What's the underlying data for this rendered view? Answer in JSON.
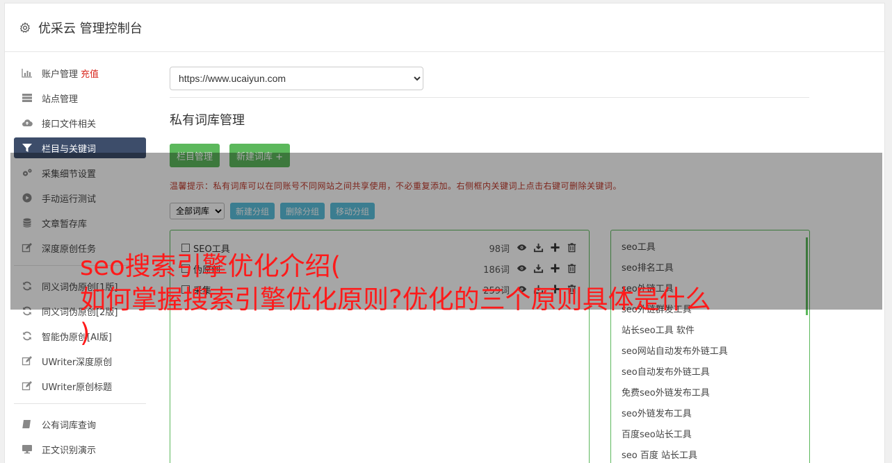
{
  "app": {
    "title": "优采云 管理控制台"
  },
  "sidebar": {
    "group1": [
      {
        "icon": "bar-chart-icon",
        "label": "账户管理",
        "extra": "充值"
      },
      {
        "icon": "server-icon",
        "label": "站点管理"
      },
      {
        "icon": "cloud-upload-icon",
        "label": "接口文件相关"
      },
      {
        "icon": "filter-icon",
        "label": "栏目与关键词",
        "active": true
      },
      {
        "icon": "cogs-icon",
        "label": "采集细节设置"
      },
      {
        "icon": "play-icon",
        "label": "手动运行测试"
      },
      {
        "icon": "database-icon",
        "label": "文章暂存库"
      },
      {
        "icon": "edit-icon",
        "label": "深度原创任务"
      }
    ],
    "group2": [
      {
        "icon": "refresh-icon",
        "label": "同义词伪原创[1版]"
      },
      {
        "icon": "refresh-icon",
        "label": "同义词伪原创[2版]"
      },
      {
        "icon": "refresh-icon",
        "label": "智能伪原创[AI版]"
      },
      {
        "icon": "edit-icon",
        "label": "UWriter深度原创"
      },
      {
        "icon": "edit-icon",
        "label": "UWriter原创标题"
      }
    ],
    "group3": [
      {
        "icon": "book-icon",
        "label": "公有词库查询"
      },
      {
        "icon": "monitor-icon",
        "label": "正文识别演示"
      }
    ]
  },
  "main": {
    "site_select": "https://www.ucaiyun.com",
    "section_title": "私有词库管理",
    "btn_column": "栏目管理",
    "btn_new_lib": "新建词库 +",
    "tip": "温馨提示：私有词库可以在同账号不同网站之间共享使用，不必重复添加。右侧框内关键词上点击右键可删除关键词。",
    "filter_select": "全部词库",
    "btn_new_group": "新建分组",
    "btn_del_group": "删除分组",
    "btn_move_group": "移动分组",
    "libraries": [
      {
        "name": "SEO工具",
        "count": "98词"
      },
      {
        "name": "伪原创",
        "count": "186词"
      },
      {
        "name": "采集",
        "count": "259词"
      }
    ],
    "keywords": [
      "seo工具",
      "seo排名工具",
      "seo外链工具",
      "seo外链群发工具",
      "站长seo工具 软件",
      "seo网站自动发布外链工具",
      "seo自动发布外链工具",
      "免费seo外链发布工具",
      "seo外链发布工具",
      "百度seo站长工具",
      "seo 百度 站长工具"
    ]
  },
  "headline": {
    "line1": "seo搜索引擎优化介绍(",
    "line2": "如何掌握搜索引擎优化原则?优化的三个原则具体是什么",
    "line3": ")"
  },
  "colors": {
    "active_nav": "#3d4d6a",
    "green": "#5cb85c",
    "blue": "#5bc0de",
    "headline": "#ff1a1a",
    "tip": "#c0392b"
  }
}
